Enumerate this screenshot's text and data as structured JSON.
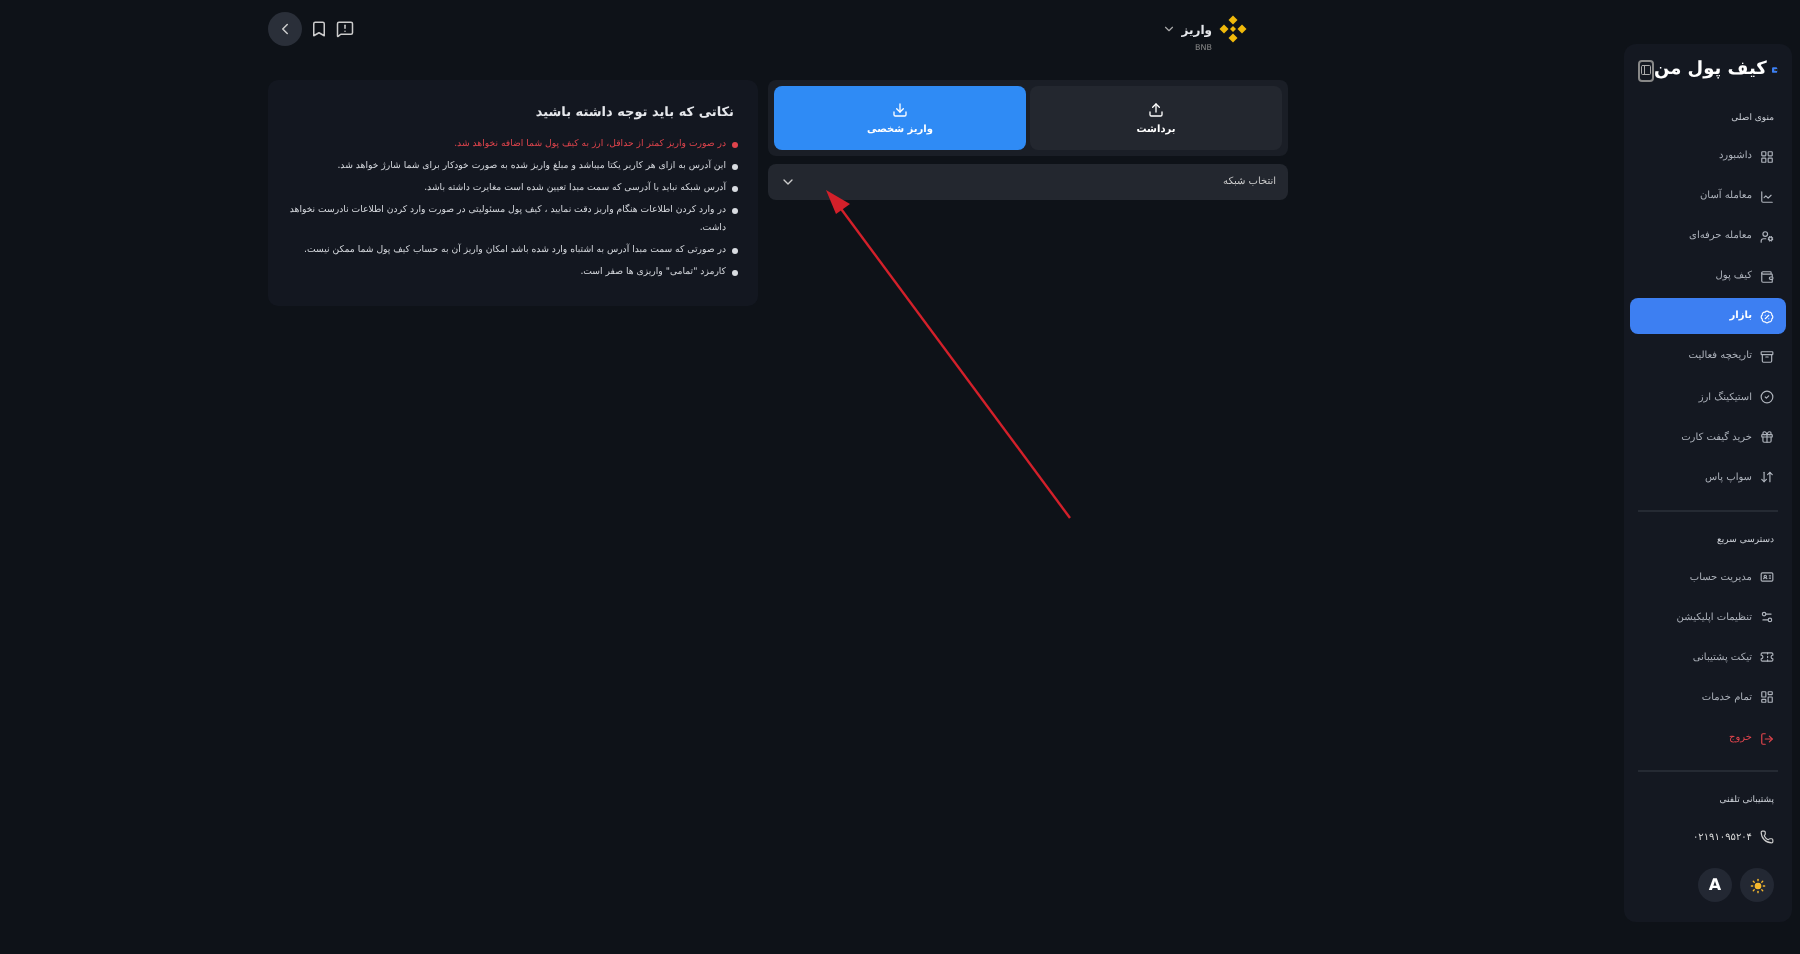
{
  "sidebar": {
    "logo": "کیف پول من",
    "sections": [
      {
        "title": "منوی اصلی",
        "items": [
          {
            "label": "داشبورد",
            "selected": false,
            "kind": "link"
          },
          {
            "label": "معامله آسان",
            "selected": false,
            "kind": "link"
          },
          {
            "label": "معامله حرفه‌ای",
            "selected": false,
            "kind": "link"
          },
          {
            "label": "کیف پول",
            "selected": false,
            "kind": "link"
          },
          {
            "label": "بازار",
            "selected": true,
            "kind": "link"
          },
          {
            "label": "تاریخچه فعالیت",
            "selected": false,
            "kind": "link"
          },
          {
            "label": "استیکینگ ارز",
            "selected": false,
            "kind": "link"
          },
          {
            "label": "خرید گیفت کارت",
            "selected": false,
            "kind": "link"
          },
          {
            "label": "سواپ پاس",
            "selected": false,
            "kind": "link"
          }
        ]
      },
      {
        "title": "دسترسی سریع",
        "items": [
          {
            "label": "مدیریت حساب",
            "selected": false,
            "kind": "link"
          },
          {
            "label": "تنظیمات اپلیکیشن",
            "selected": false,
            "kind": "link"
          },
          {
            "label": "تیکت پشتیبانی",
            "selected": false,
            "kind": "link"
          },
          {
            "label": "تمام خدمات",
            "selected": false,
            "kind": "link"
          },
          {
            "label": "خروج",
            "selected": false,
            "kind": "exit"
          }
        ]
      }
    ],
    "support": {
      "title": "پشتیبانی تلفنی",
      "phone": "۰۲۱۹۱۰۹۵۲۰۴"
    },
    "font_button": "A"
  },
  "header": {
    "title": "واریز",
    "coin": "BNB"
  },
  "tabs": [
    {
      "label": "برداشت",
      "selected": false
    },
    {
      "label": "واریز شخصی",
      "selected": true
    }
  ],
  "network_select": {
    "placeholder": "انتخاب شبکه"
  },
  "notes": {
    "title": "نکاتی که باید توجه داشته باشید",
    "items": [
      {
        "kind": "warning",
        "text": "در صورت واریز کمتر از حداقل، ارز به کیف پول شما اضافه نخواهد شد."
      },
      {
        "kind": "note",
        "text": "این آدرس به ازای هر کاربر یکتا میباشد و مبلغ واریز شده به صورت خودکار برای شما شارژ خواهد شد."
      },
      {
        "kind": "note",
        "text": "آدرس شبکه نباید با آدرسی که سمت مبدا تعیین شده است مغایرت داشته باشد."
      },
      {
        "kind": "note",
        "text": "در وارد کردن اطلاعات هنگام واریز دقت نمایید ، کیف پول مسئولیتی در صورت وارد کردن اطلاعات نادرست نخواهد داشت."
      },
      {
        "kind": "note",
        "text": "در صورتی که سمت مبدا آدرس به اشتباه وارد شده باشد امکان واریز آن به حساب کیف پول شما ممکن نیست."
      },
      {
        "kind": "note",
        "text": "کارمزد \"تمامی\" واریزی ها صفر است."
      }
    ]
  }
}
